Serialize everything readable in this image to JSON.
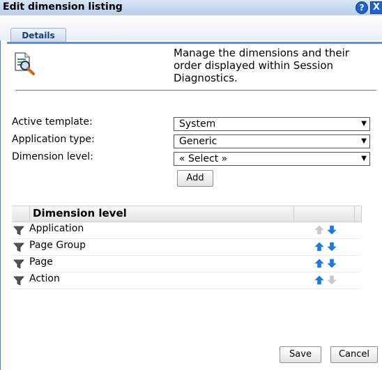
{
  "dialog": {
    "title": "Edit dimension listing",
    "help_symbol": "?",
    "close_symbol": "X"
  },
  "tabs": [
    {
      "label": "Details",
      "active": true
    }
  ],
  "description": "Manage the dimensions and their order displayed within Session Diagnostics.",
  "fields": {
    "active_template": {
      "label": "Active template:",
      "value": "System"
    },
    "application_type": {
      "label": "Application type:",
      "value": "Generic"
    },
    "dimension_level": {
      "label": "Dimension level:",
      "value": "« Select »"
    }
  },
  "add_button": "Add",
  "grid": {
    "header": "Dimension level",
    "rows": [
      {
        "label": "Application",
        "up_enabled": false,
        "down_enabled": true
      },
      {
        "label": "Page Group",
        "up_enabled": true,
        "down_enabled": true
      },
      {
        "label": "Page",
        "up_enabled": true,
        "down_enabled": true
      },
      {
        "label": "Action",
        "up_enabled": true,
        "down_enabled": false
      }
    ]
  },
  "footer": {
    "save_label": "Save",
    "cancel_label": "Cancel"
  },
  "colors": {
    "title_bar": "#c6d9ef",
    "accent_blue": "#1f63c8",
    "arrow_enabled": "#1f7ae0",
    "arrow_disabled": "#c8c8c8"
  }
}
